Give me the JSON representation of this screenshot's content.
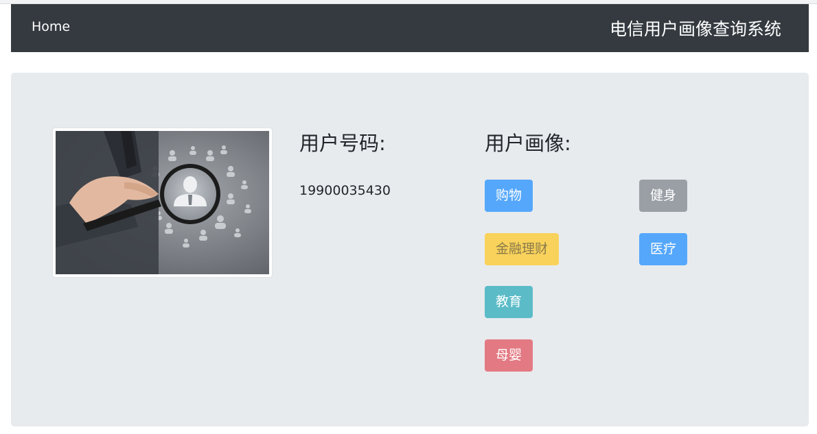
{
  "navbar": {
    "home_label": "Home",
    "title": "电信用户画像查询系统"
  },
  "profile": {
    "number_label": "用户号码:",
    "number_value": "19900035430",
    "portrait_label": "用户画像:"
  },
  "tags": [
    {
      "label": "购物",
      "color": "#55a7fb"
    },
    {
      "label": "健身",
      "color": "#999fa5"
    },
    {
      "label": "金融理财",
      "color": "#f8d25b"
    },
    {
      "label": "医疗",
      "color": "#55a7fb"
    },
    {
      "label": "教育",
      "color": "#5bbcc8"
    },
    {
      "label": "母婴",
      "color": "#e37a83"
    }
  ],
  "colors": {
    "navbar_bg": "#343a40",
    "panel_bg": "#e8ebee"
  }
}
